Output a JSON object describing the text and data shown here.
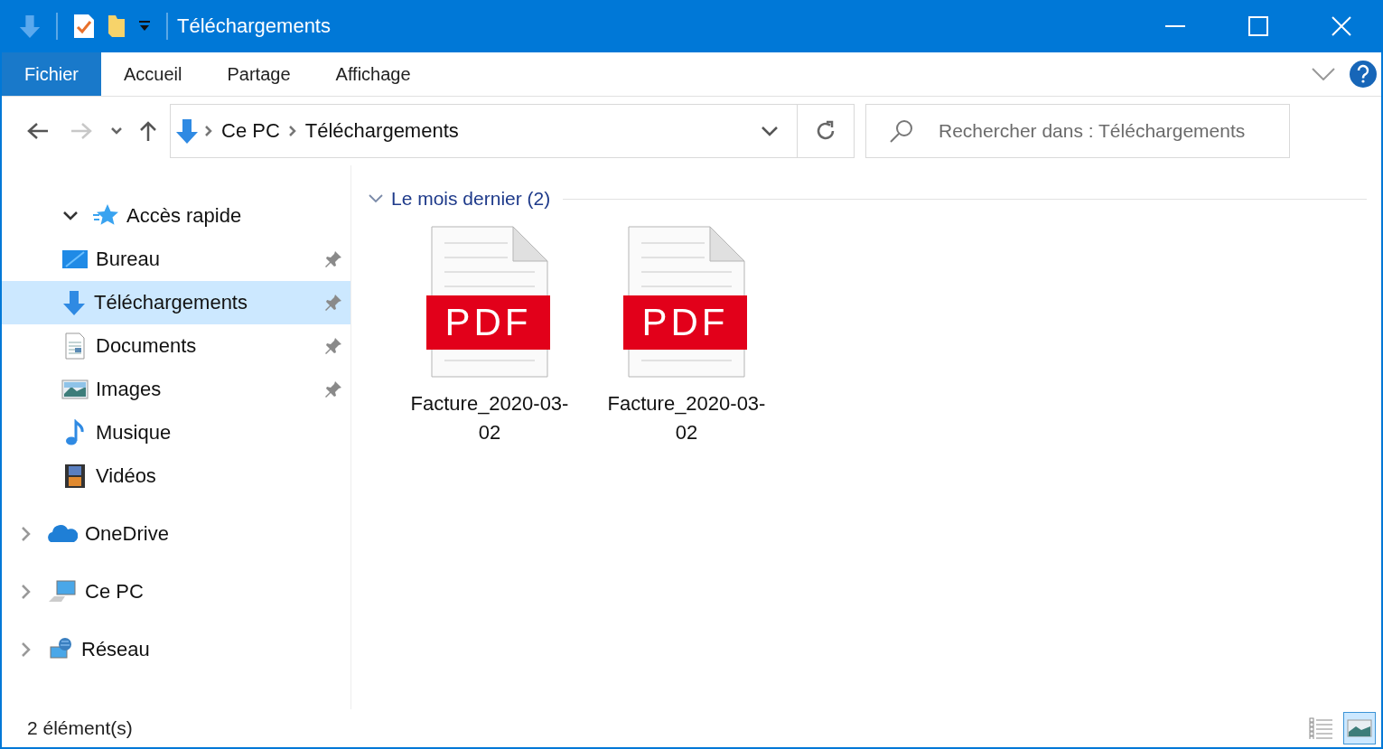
{
  "window": {
    "title": "Téléchargements"
  },
  "ribbon": {
    "tabs": [
      {
        "label": "Fichier",
        "selected": true
      },
      {
        "label": "Accueil",
        "selected": false
      },
      {
        "label": "Partage",
        "selected": false
      },
      {
        "label": "Affichage",
        "selected": false
      }
    ]
  },
  "address": {
    "path": [
      "Ce PC",
      "Téléchargements"
    ]
  },
  "search": {
    "placeholder": "Rechercher dans : Téléchargements"
  },
  "sidebar": {
    "items": [
      {
        "label": "Accès rapide",
        "kind": "star",
        "expanded": true,
        "selected": false,
        "children": [
          {
            "label": "Bureau",
            "kind": "desktop",
            "pinned": true,
            "selected": false
          },
          {
            "label": "Téléchargements",
            "kind": "download",
            "pinned": true,
            "selected": true
          },
          {
            "label": "Documents",
            "kind": "document",
            "pinned": true,
            "selected": false
          },
          {
            "label": "Images",
            "kind": "image",
            "pinned": true,
            "selected": false
          },
          {
            "label": "Musique",
            "kind": "music",
            "pinned": false,
            "selected": false
          },
          {
            "label": "Vidéos",
            "kind": "video",
            "pinned": false,
            "selected": false
          }
        ]
      },
      {
        "label": "OneDrive",
        "kind": "cloud",
        "expanded": false,
        "selected": false
      },
      {
        "label": "Ce PC",
        "kind": "computer",
        "expanded": false,
        "selected": false
      },
      {
        "label": "Réseau",
        "kind": "network",
        "expanded": false,
        "selected": false
      }
    ]
  },
  "group": {
    "label": "Le mois dernier (2)",
    "expanded": true
  },
  "files": [
    {
      "name": "Facture_2020-03-02",
      "badge": "PDF"
    },
    {
      "name": "Facture_2020-03-02",
      "badge": "PDF"
    }
  ],
  "status_bar": {
    "count": "2 élément(s)",
    "views": [
      {
        "kind": "details",
        "selected": false
      },
      {
        "kind": "large_icons",
        "selected": true
      }
    ]
  }
}
